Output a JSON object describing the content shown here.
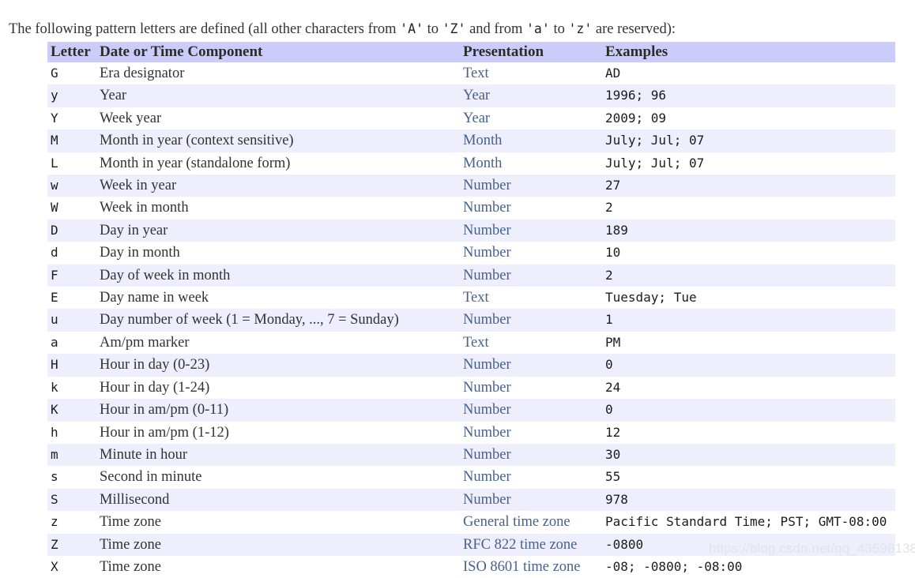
{
  "intro": {
    "part1": "The following pattern letters are defined (all other characters from ",
    "q1": "'A'",
    "part2": " to ",
    "q2": "'Z'",
    "part3": " and from ",
    "q3": "'a'",
    "part4": " to ",
    "q4": "'z'",
    "part5": " are reserved):"
  },
  "table": {
    "headers": {
      "letter": "Letter",
      "component": "Date or Time Component",
      "presentation": "Presentation",
      "examples": "Examples"
    },
    "rows": [
      {
        "letter": "G",
        "component": "Era designator",
        "presentation": "Text",
        "examples": "AD"
      },
      {
        "letter": "y",
        "component": "Year",
        "presentation": "Year",
        "examples": "1996; 96"
      },
      {
        "letter": "Y",
        "component": "Week year",
        "presentation": "Year",
        "examples": "2009; 09"
      },
      {
        "letter": "M",
        "component": "Month in year (context sensitive)",
        "presentation": "Month",
        "examples": "July; Jul; 07"
      },
      {
        "letter": "L",
        "component": "Month in year (standalone form)",
        "presentation": "Month",
        "examples": "July; Jul; 07"
      },
      {
        "letter": "w",
        "component": "Week in year",
        "presentation": "Number",
        "examples": "27"
      },
      {
        "letter": "W",
        "component": "Week in month",
        "presentation": "Number",
        "examples": "2"
      },
      {
        "letter": "D",
        "component": "Day in year",
        "presentation": "Number",
        "examples": "189"
      },
      {
        "letter": "d",
        "component": "Day in month",
        "presentation": "Number",
        "examples": "10"
      },
      {
        "letter": "F",
        "component": "Day of week in month",
        "presentation": "Number",
        "examples": "2"
      },
      {
        "letter": "E",
        "component": "Day name in week",
        "presentation": "Text",
        "examples": "Tuesday; Tue"
      },
      {
        "letter": "u",
        "component": "Day number of week (1 = Monday, ..., 7 = Sunday)",
        "presentation": "Number",
        "examples": "1"
      },
      {
        "letter": "a",
        "component": "Am/pm marker",
        "presentation": "Text",
        "examples": "PM"
      },
      {
        "letter": "H",
        "component": "Hour in day (0-23)",
        "presentation": "Number",
        "examples": "0"
      },
      {
        "letter": "k",
        "component": "Hour in day (1-24)",
        "presentation": "Number",
        "examples": "24"
      },
      {
        "letter": "K",
        "component": "Hour in am/pm (0-11)",
        "presentation": "Number",
        "examples": "0"
      },
      {
        "letter": "h",
        "component": "Hour in am/pm (1-12)",
        "presentation": "Number",
        "examples": "12"
      },
      {
        "letter": "m",
        "component": "Minute in hour",
        "presentation": "Number",
        "examples": "30"
      },
      {
        "letter": "s",
        "component": "Second in minute",
        "presentation": "Number",
        "examples": "55"
      },
      {
        "letter": "S",
        "component": "Millisecond",
        "presentation": "Number",
        "examples": "978"
      },
      {
        "letter": "z",
        "component": "Time zone",
        "presentation": "General time zone",
        "examples": "Pacific Standard Time; PST; GMT-08:00"
      },
      {
        "letter": "Z",
        "component": "Time zone",
        "presentation": "RFC 822 time zone",
        "examples": "-0800"
      },
      {
        "letter": "X",
        "component": "Time zone",
        "presentation": "ISO 8601 time zone",
        "examples": "-08; -0800; -08:00"
      }
    ]
  },
  "watermark": "https://blog.csdn.net/qq_43598138",
  "colors": {
    "header_bg": "#ccccfa",
    "stripe_bg": "#eeeefc",
    "presentation_text": "#46618c",
    "body_text": "#333333",
    "watermark_text": "#e3e3e8"
  }
}
